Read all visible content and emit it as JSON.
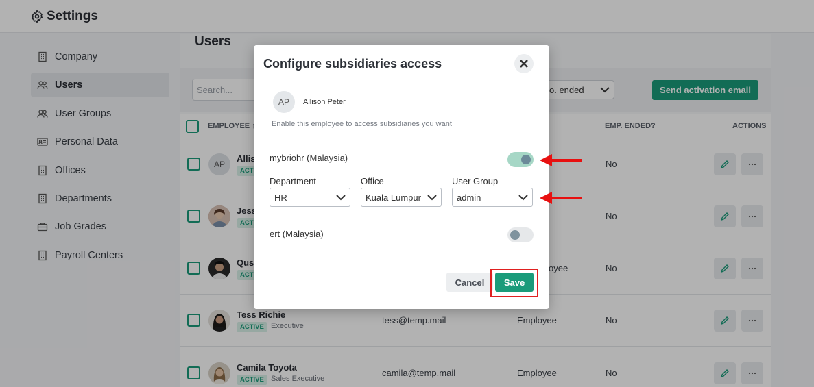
{
  "header": {
    "title": "Settings"
  },
  "sidebar": {
    "items": [
      {
        "label": "Company",
        "icon": "building-icon"
      },
      {
        "label": "Users",
        "icon": "users-icon",
        "active": true
      },
      {
        "label": "User Groups",
        "icon": "users-icon"
      },
      {
        "label": "Personal Data",
        "icon": "id-card-icon"
      },
      {
        "label": "Offices",
        "icon": "building-icon"
      },
      {
        "label": "Departments",
        "icon": "building-icon"
      },
      {
        "label": "Job Grades",
        "icon": "briefcase-icon"
      },
      {
        "label": "Payroll Centers",
        "icon": "building-icon"
      }
    ]
  },
  "main": {
    "title": "Users",
    "search_placeholder": "Search...",
    "emp_filter_value": "o. ended",
    "send_button": "Send activation email",
    "columns": {
      "employee": "EMPLOYEE ↑",
      "emp_ended": "EMP. ENDED?",
      "actions": "ACTIONS"
    },
    "rows": [
      {
        "name": "Allis",
        "initials": "AP",
        "badge": "ACTI",
        "job": "",
        "email": "",
        "role": "",
        "ended": "No"
      },
      {
        "name": "Jess",
        "initials": "",
        "badge": "ACTI",
        "job": "",
        "email": "",
        "role": "",
        "ended": "No"
      },
      {
        "name": "Qusl",
        "initials": "",
        "badge": "ACTI",
        "job": "",
        "email": "",
        "role": "oyee",
        "ended": "No"
      },
      {
        "name": "Tess Richie",
        "initials": "",
        "badge": "ACTIVE",
        "job": "Executive",
        "email": "tess@temp.mail",
        "role": "Employee",
        "ended": "No"
      },
      {
        "name": "Camila Toyota",
        "initials": "",
        "badge": "ACTIVE",
        "job": "Sales Executive",
        "email": "camila@temp.mail",
        "role": "Employee",
        "ended": "No"
      }
    ]
  },
  "modal": {
    "title": "Configure subsidiaries access",
    "employee_initials": "AP",
    "employee_name": "Allison Peter",
    "hint": "Enable this employee to access subsidiaries you want",
    "subsidiaries": [
      {
        "name": "mybriohr (Malaysia)",
        "enabled": true
      },
      {
        "name": "ert (Malaysia)",
        "enabled": false
      }
    ],
    "fields": {
      "department_label": "Department",
      "department_value": "HR",
      "office_label": "Office",
      "office_value": "Kuala Lumpur",
      "group_label": "User Group",
      "group_value": "admin"
    },
    "cancel_label": "Cancel",
    "save_label": "Save"
  },
  "colors": {
    "accent": "#1a9b7a",
    "highlight": "#e02020"
  }
}
